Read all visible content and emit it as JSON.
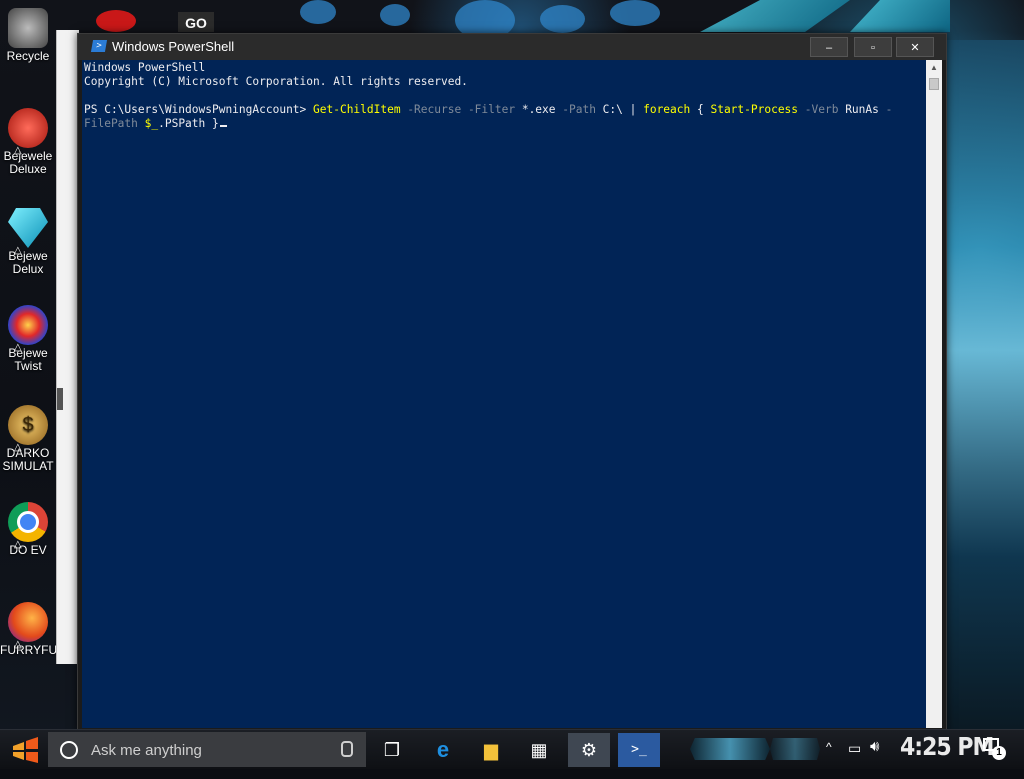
{
  "desktop": {
    "icons": [
      {
        "label": "Recycle",
        "icon": "recycle-bin-icon",
        "color": "#7a7a7a"
      },
      {
        "label": "Bejewele\nDeluxe",
        "icon": "bejeweled-2-icon",
        "color": "#d23a2b"
      },
      {
        "label": "Bejewe\nDelux",
        "icon": "bejeweled-diamond-icon",
        "color": "#1fb7d9"
      },
      {
        "label": "Bejewe\nTwist",
        "icon": "bejeweled-twist-icon",
        "color": "#3a4fd0"
      },
      {
        "label": "DARKO\nSIMULAT",
        "icon": "money-bag-icon",
        "color": "#c79a3a"
      },
      {
        "label": "DO EV",
        "icon": "chrome-icon",
        "color": "#2f8f3a"
      },
      {
        "label": "FURRYFU",
        "icon": "firefox-icon",
        "color": "#e66a1f"
      }
    ],
    "top_badge": "GO"
  },
  "window": {
    "title": "Windows PowerShell",
    "minimize": "–",
    "maximize": "▫",
    "close": "✕"
  },
  "console": {
    "line1": "Windows PowerShell",
    "line2": "Copyright (C) Microsoft Corporation. All rights reserved.",
    "prompt": "PS C:\\Users\\WindowsPwningAccount> ",
    "cmd1": "Get-ChildItem",
    "p_recurse": " -Recurse",
    "p_filter": " -Filter",
    "v_filter": " *.exe",
    "p_path": " -Path",
    "v_path": " C:\\ | ",
    "kw_foreach": "foreach",
    "brace_open": " { ",
    "cmd2": "Start-Process",
    "p_verb": " -Verb",
    "v_verb": " RunAs ",
    "p_dash": "-",
    "p_filepath": "FilePath",
    "var": " $_",
    "prop": ".PSPath }",
    "colors": {
      "background": "#012456",
      "text": "#eeedf0",
      "command": "#ffff00",
      "parameter": "#7f8a99"
    }
  },
  "taskbar": {
    "search_placeholder": "Ask me anything",
    "items": [
      {
        "name": "task-view-icon",
        "glyph": "❐"
      },
      {
        "name": "edge-icon",
        "glyph": "e"
      },
      {
        "name": "file-explorer-icon",
        "glyph": "▆"
      },
      {
        "name": "store-icon",
        "glyph": "▦"
      },
      {
        "name": "settings-icon",
        "glyph": "⚙"
      },
      {
        "name": "powershell-icon",
        "glyph": ">_"
      }
    ],
    "clock": "4:25 PM",
    "notification_count": "1",
    "tray_arrow": "^"
  }
}
